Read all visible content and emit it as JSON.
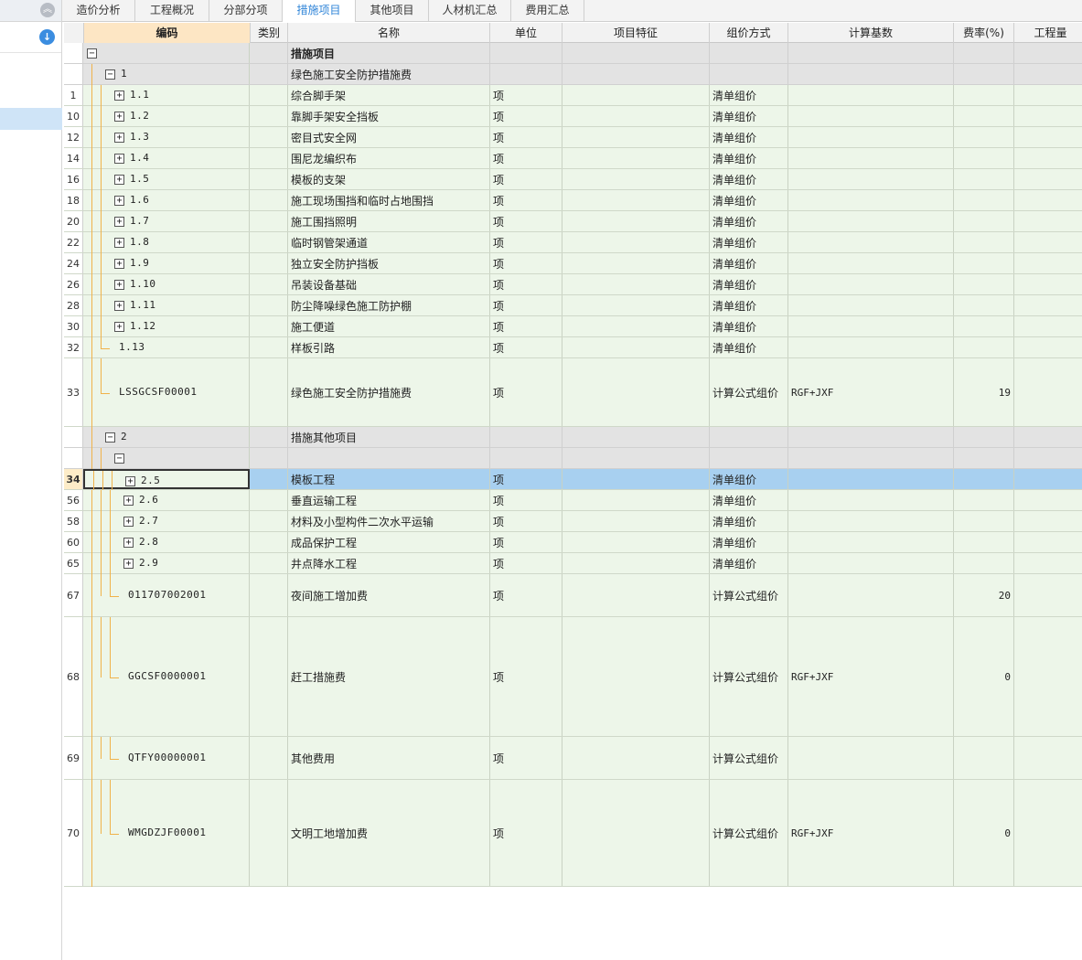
{
  "tabs": [
    {
      "label": "造价分析",
      "active": false
    },
    {
      "label": "工程概况",
      "active": false
    },
    {
      "label": "分部分项",
      "active": false
    },
    {
      "label": "措施项目",
      "active": true
    },
    {
      "label": "其他项目",
      "active": false
    },
    {
      "label": "人材机汇总",
      "active": false
    },
    {
      "label": "费用汇总",
      "active": false
    }
  ],
  "leftnav": {
    "collapse_icon": "double-chevron-up-icon",
    "download_icon": "download-icon"
  },
  "columns": {
    "code": "编码",
    "category": "类别",
    "name": "名称",
    "unit": "单位",
    "feature": "项目特征",
    "pricing": "组价方式",
    "base": "计算基数",
    "rate": "费率(%)",
    "qty": "工程量"
  },
  "rows": [
    {
      "type": "gray",
      "rn": "",
      "code": "",
      "name": "措施项目",
      "unit": "",
      "pricing": "",
      "base": "",
      "rate": "",
      "toggle": "−",
      "level": 0,
      "bold": true
    },
    {
      "type": "gray",
      "rn": "",
      "code": "1",
      "name": "绿色施工安全防护措施费",
      "unit": "",
      "pricing": "",
      "base": "",
      "rate": "",
      "toggle": "−",
      "level": 1
    },
    {
      "type": "green",
      "rn": "1",
      "code": "1.1",
      "name": "综合脚手架",
      "unit": "项",
      "pricing": "清单组价",
      "base": "",
      "rate": "",
      "toggle": "+",
      "level": 2
    },
    {
      "type": "green",
      "rn": "10",
      "code": "1.2",
      "name": "靠脚手架安全挡板",
      "unit": "项",
      "pricing": "清单组价",
      "base": "",
      "rate": "",
      "toggle": "+",
      "level": 2
    },
    {
      "type": "green",
      "rn": "12",
      "code": "1.3",
      "name": "密目式安全网",
      "unit": "项",
      "pricing": "清单组价",
      "base": "",
      "rate": "",
      "toggle": "+",
      "level": 2
    },
    {
      "type": "green",
      "rn": "14",
      "code": "1.4",
      "name": "围尼龙编织布",
      "unit": "项",
      "pricing": "清单组价",
      "base": "",
      "rate": "",
      "toggle": "+",
      "level": 2
    },
    {
      "type": "green",
      "rn": "16",
      "code": "1.5",
      "name": "模板的支架",
      "unit": "项",
      "pricing": "清单组价",
      "base": "",
      "rate": "",
      "toggle": "+",
      "level": 2
    },
    {
      "type": "green",
      "rn": "18",
      "code": "1.6",
      "name": "施工现场围挡和临时占地围挡",
      "unit": "项",
      "pricing": "清单组价",
      "base": "",
      "rate": "",
      "toggle": "+",
      "level": 2
    },
    {
      "type": "green",
      "rn": "20",
      "code": "1.7",
      "name": "施工围挡照明",
      "unit": "项",
      "pricing": "清单组价",
      "base": "",
      "rate": "",
      "toggle": "+",
      "level": 2
    },
    {
      "type": "green",
      "rn": "22",
      "code": "1.8",
      "name": "临时钢管架通道",
      "unit": "项",
      "pricing": "清单组价",
      "base": "",
      "rate": "",
      "toggle": "+",
      "level": 2
    },
    {
      "type": "green",
      "rn": "24",
      "code": "1.9",
      "name": "独立安全防护挡板",
      "unit": "项",
      "pricing": "清单组价",
      "base": "",
      "rate": "",
      "toggle": "+",
      "level": 2
    },
    {
      "type": "green",
      "rn": "26",
      "code": "1.10",
      "name": "吊装设备基础",
      "unit": "项",
      "pricing": "清单组价",
      "base": "",
      "rate": "",
      "toggle": "+",
      "level": 2
    },
    {
      "type": "green",
      "rn": "28",
      "code": "1.11",
      "name": "防尘降噪绿色施工防护棚",
      "unit": "项",
      "pricing": "清单组价",
      "base": "",
      "rate": "",
      "toggle": "+",
      "level": 2
    },
    {
      "type": "green",
      "rn": "30",
      "code": "1.12",
      "name": "施工便道",
      "unit": "项",
      "pricing": "清单组价",
      "base": "",
      "rate": "",
      "toggle": "+",
      "level": 2
    },
    {
      "type": "green",
      "rn": "32",
      "code": "1.13",
      "name": "样板引路",
      "unit": "项",
      "pricing": "清单组价",
      "base": "",
      "rate": "",
      "toggle": "",
      "level": 2
    },
    {
      "type": "green",
      "rn": "33",
      "code": "LSSGCSF00001",
      "name": "绿色施工安全防护措施费",
      "unit": "项",
      "pricing": "计算公式组价",
      "base": "RGF+JXF",
      "rate": "19",
      "toggle": "",
      "level": 2
    },
    {
      "type": "gray",
      "rn": "",
      "code": "2",
      "name": "措施其他项目",
      "unit": "",
      "pricing": "",
      "base": "",
      "rate": "",
      "toggle": "−",
      "level": 1
    },
    {
      "type": "gray",
      "rn": "",
      "code": "",
      "name": "",
      "unit": "",
      "pricing": "",
      "base": "",
      "rate": "",
      "toggle": "−",
      "level": 2
    },
    {
      "type": "sel",
      "rn": "34",
      "code": "2.5",
      "name": "模板工程",
      "unit": "项",
      "pricing": "清单组价",
      "base": "",
      "rate": "",
      "toggle": "+",
      "level": 3
    },
    {
      "type": "green",
      "rn": "56",
      "code": "2.6",
      "name": "垂直运输工程",
      "unit": "项",
      "pricing": "清单组价",
      "base": "",
      "rate": "",
      "toggle": "+",
      "level": 3
    },
    {
      "type": "green",
      "rn": "58",
      "code": "2.7",
      "name": "材料及小型构件二次水平运输",
      "unit": "项",
      "pricing": "清单组价",
      "base": "",
      "rate": "",
      "toggle": "+",
      "level": 3
    },
    {
      "type": "green",
      "rn": "60",
      "code": "2.8",
      "name": "成品保护工程",
      "unit": "项",
      "pricing": "清单组价",
      "base": "",
      "rate": "",
      "toggle": "+",
      "level": 3
    },
    {
      "type": "green",
      "rn": "65",
      "code": "2.9",
      "name": "井点降水工程",
      "unit": "项",
      "pricing": "清单组价",
      "base": "",
      "rate": "",
      "toggle": "+",
      "level": 3
    },
    {
      "type": "green",
      "rn": "67",
      "code": "011707002001",
      "name": "夜间施工增加费",
      "unit": "项",
      "pricing": "计算公式组价",
      "base": "",
      "rate": "20",
      "toggle": "",
      "level": 3
    },
    {
      "type": "green",
      "rn": "68",
      "code": "GGCSF0000001",
      "name": "赶工措施费",
      "unit": "项",
      "pricing": "计算公式组价",
      "base": "RGF+JXF",
      "rate": "0",
      "toggle": "",
      "level": 3
    },
    {
      "type": "green",
      "rn": "69",
      "code": "QTFY00000001",
      "name": "其他费用",
      "unit": "项",
      "pricing": "计算公式组价",
      "base": "",
      "rate": "",
      "toggle": "",
      "level": 3
    },
    {
      "type": "green",
      "rn": "70",
      "code": "WMGDZJF00001",
      "name": "文明工地增加费",
      "unit": "项",
      "pricing": "计算公式组价",
      "base": "RGF+JXF",
      "rate": "0",
      "toggle": "",
      "level": 3
    }
  ]
}
